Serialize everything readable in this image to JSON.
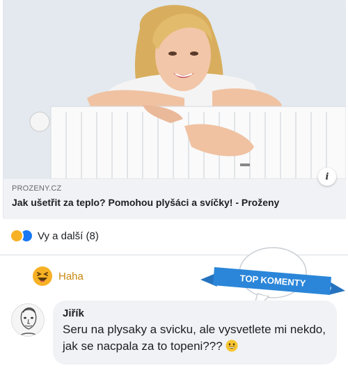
{
  "link_preview": {
    "domain": "PROZENY.CZ",
    "title": "Jak ušetřit za teplo? Pomohou plyšáci a svíčky! - Proženy",
    "info_icon": "info-icon",
    "image": "woman-hugging-radiator"
  },
  "reactions": {
    "icons": [
      "haha-icon",
      "like-icon"
    ],
    "label": "Vy a další (8)"
  },
  "haha_action": {
    "icon": "haha-emoji-icon",
    "label": "Haha"
  },
  "top_comments_badge": {
    "label": "TOP KOMENTY",
    "color": "#2b86d9"
  },
  "comment": {
    "author": "Jiřík",
    "text": "Seru na plysaky a svicku, ale vysvetlete mi nekdo, jak se nacpala za to topeni???",
    "trailing_emoji": "grin-emoji-icon"
  },
  "colors": {
    "haha_yellow": "#f7b125",
    "like_blue": "#1877f2",
    "bubble_gray": "#f0f2f5"
  }
}
